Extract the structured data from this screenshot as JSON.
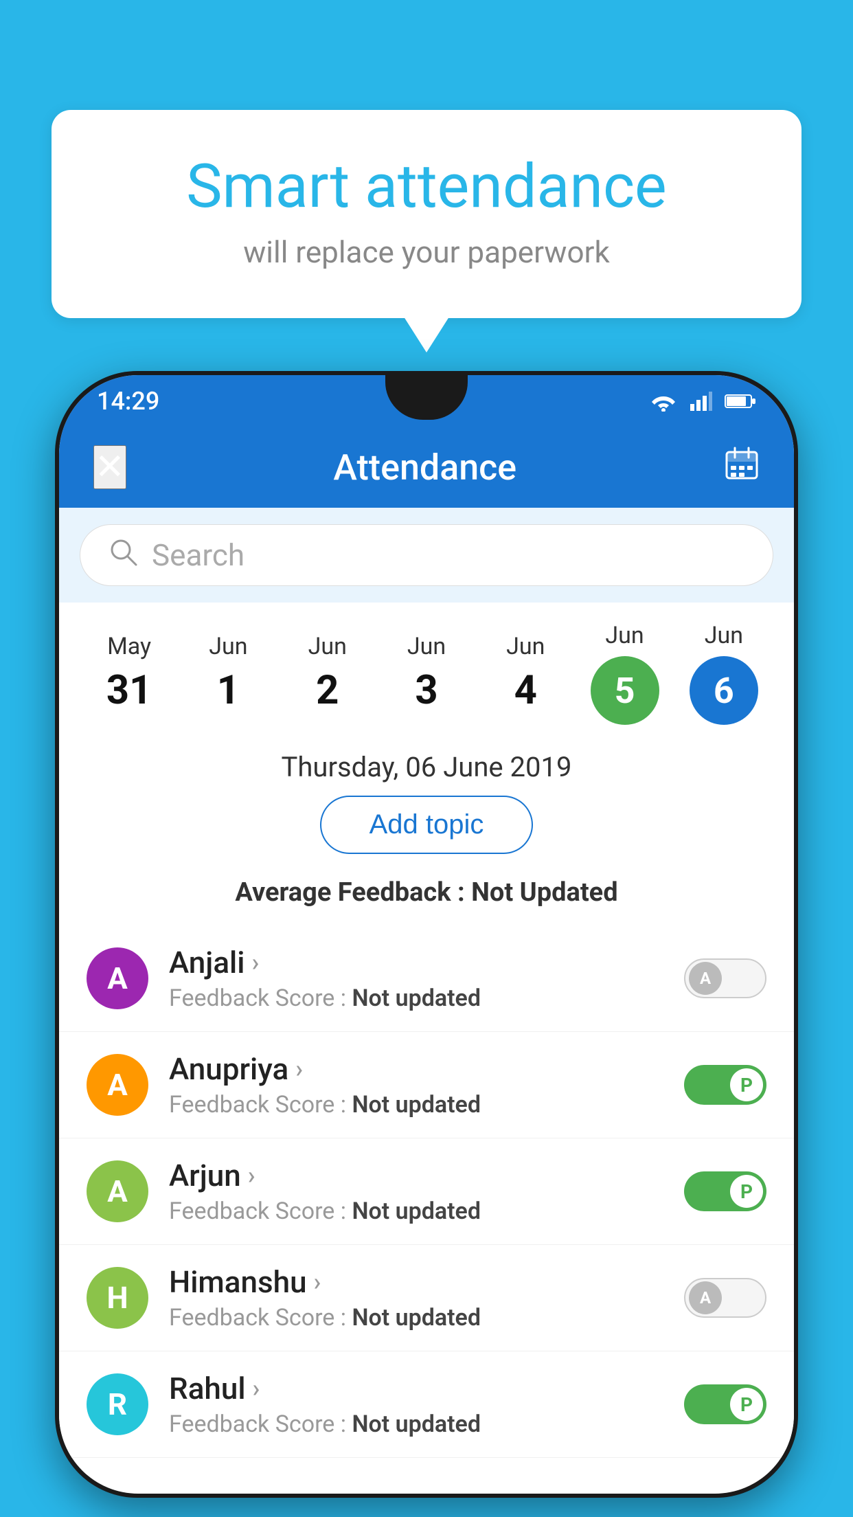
{
  "app": {
    "background_color": "#29b6e8"
  },
  "speech_bubble": {
    "title": "Smart attendance",
    "subtitle": "will replace your paperwork"
  },
  "status_bar": {
    "time": "14:29"
  },
  "header": {
    "title": "Attendance",
    "close_label": "✕",
    "calendar_icon": "📅"
  },
  "search": {
    "placeholder": "Search"
  },
  "date_strip": {
    "dates": [
      {
        "month": "May",
        "day": "31",
        "selected": false
      },
      {
        "month": "Jun",
        "day": "1",
        "selected": false
      },
      {
        "month": "Jun",
        "day": "2",
        "selected": false
      },
      {
        "month": "Jun",
        "day": "3",
        "selected": false
      },
      {
        "month": "Jun",
        "day": "4",
        "selected": false
      },
      {
        "month": "Jun",
        "day": "5",
        "selected": "green"
      },
      {
        "month": "Jun",
        "day": "6",
        "selected": "blue"
      }
    ]
  },
  "selected_date_text": "Thursday, 06 June 2019",
  "add_topic_label": "Add topic",
  "avg_feedback_label": "Average Feedback :",
  "avg_feedback_value": "Not Updated",
  "students": [
    {
      "name": "Anjali",
      "avatar_letter": "A",
      "avatar_color": "#9c27b0",
      "feedback_label": "Feedback Score :",
      "feedback_value": "Not updated",
      "toggle_state": "off",
      "toggle_letter": "A"
    },
    {
      "name": "Anupriya",
      "avatar_letter": "A",
      "avatar_color": "#ff9800",
      "feedback_label": "Feedback Score :",
      "feedback_value": "Not updated",
      "toggle_state": "on",
      "toggle_letter": "P"
    },
    {
      "name": "Arjun",
      "avatar_letter": "A",
      "avatar_color": "#8bc34a",
      "feedback_label": "Feedback Score :",
      "feedback_value": "Not updated",
      "toggle_state": "on",
      "toggle_letter": "P"
    },
    {
      "name": "Himanshu",
      "avatar_letter": "H",
      "avatar_color": "#8bc34a",
      "feedback_label": "Feedback Score :",
      "feedback_value": "Not updated",
      "toggle_state": "off",
      "toggle_letter": "A"
    },
    {
      "name": "Rahul",
      "avatar_letter": "R",
      "avatar_color": "#26c6da",
      "feedback_label": "Feedback Score :",
      "feedback_value": "Not updated",
      "toggle_state": "on",
      "toggle_letter": "P"
    }
  ]
}
